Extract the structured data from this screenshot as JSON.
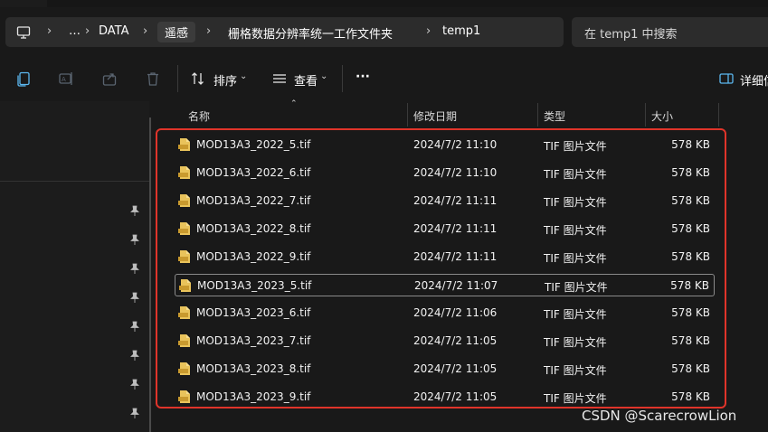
{
  "breadcrumb": {
    "overflow": "…",
    "items": [
      "DATA",
      "遥感",
      "栅格数据分辨率统一工作文件夹",
      "temp1"
    ]
  },
  "search": {
    "placeholder": "在 temp1 中搜索"
  },
  "toolbar": {
    "sort_label": "排序",
    "view_label": "查看",
    "more_label": "···",
    "details_label": "详细信"
  },
  "columns": {
    "name": "名称",
    "modified": "修改日期",
    "type": "类型",
    "size": "大小"
  },
  "files": [
    {
      "name": "MOD13A3_2022_5.tif",
      "modified": "2024/7/2 11:10",
      "type": "TIF 图片文件",
      "size": "578 KB"
    },
    {
      "name": "MOD13A3_2022_6.tif",
      "modified": "2024/7/2 11:10",
      "type": "TIF 图片文件",
      "size": "578 KB"
    },
    {
      "name": "MOD13A3_2022_7.tif",
      "modified": "2024/7/2 11:11",
      "type": "TIF 图片文件",
      "size": "578 KB"
    },
    {
      "name": "MOD13A3_2022_8.tif",
      "modified": "2024/7/2 11:11",
      "type": "TIF 图片文件",
      "size": "578 KB"
    },
    {
      "name": "MOD13A3_2022_9.tif",
      "modified": "2024/7/2 11:11",
      "type": "TIF 图片文件",
      "size": "578 KB"
    },
    {
      "name": "MOD13A3_2023_5.tif",
      "modified": "2024/7/2 11:07",
      "type": "TIF 图片文件",
      "size": "578 KB"
    },
    {
      "name": "MOD13A3_2023_6.tif",
      "modified": "2024/7/2 11:06",
      "type": "TIF 图片文件",
      "size": "578 KB"
    },
    {
      "name": "MOD13A3_2023_7.tif",
      "modified": "2024/7/2 11:05",
      "type": "TIF 图片文件",
      "size": "578 KB"
    },
    {
      "name": "MOD13A3_2023_8.tif",
      "modified": "2024/7/2 11:05",
      "type": "TIF 图片文件",
      "size": "578 KB"
    },
    {
      "name": "MOD13A3_2023_9.tif",
      "modified": "2024/7/2 11:05",
      "type": "TIF 图片文件",
      "size": "578 KB"
    }
  ],
  "focused_file": "MOD13A3_2023_5.tif",
  "watermark": "CSDN @ScarecrowLion",
  "colors": {
    "background": "#191919",
    "highlight_box": "#e0342a",
    "tif_icon": "#e9c35b",
    "details_icon": "#5cb8f0"
  },
  "icons": [
    "computer-icon",
    "copy-icon",
    "rename-icon",
    "share-icon",
    "delete-icon",
    "sort-icon",
    "view-icon",
    "details-pane-icon",
    "pin-icon",
    "tif-file-icon"
  ]
}
